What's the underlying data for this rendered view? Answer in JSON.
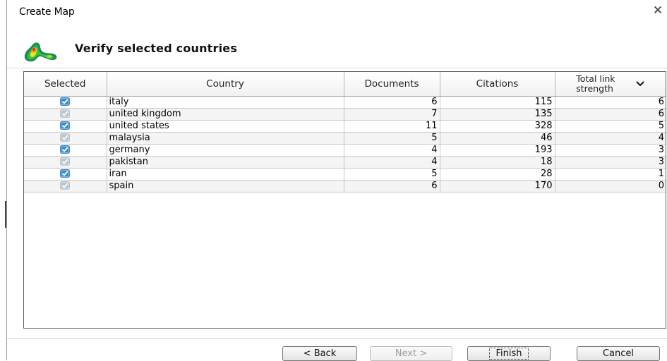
{
  "window": {
    "title": "Create Map",
    "close_icon": "close-icon"
  },
  "header": {
    "icon": "density-map-icon",
    "title": "Verify selected countries"
  },
  "table": {
    "columns": [
      "Selected",
      "Country",
      "Documents",
      "Citations",
      "Total link strength"
    ],
    "sorted_column": "Total link strength",
    "sort_direction": "descending",
    "rows": [
      {
        "selected": true,
        "country": "italy",
        "documents": "6",
        "citations": "115",
        "total_link_strength": "6"
      },
      {
        "selected": true,
        "country": "united kingdom",
        "documents": "7",
        "citations": "135",
        "total_link_strength": "6"
      },
      {
        "selected": true,
        "country": "united states",
        "documents": "11",
        "citations": "328",
        "total_link_strength": "5"
      },
      {
        "selected": true,
        "country": "malaysia",
        "documents": "5",
        "citations": "46",
        "total_link_strength": "4"
      },
      {
        "selected": true,
        "country": "germany",
        "documents": "4",
        "citations": "193",
        "total_link_strength": "3"
      },
      {
        "selected": true,
        "country": "pakistan",
        "documents": "4",
        "citations": "18",
        "total_link_strength": "3"
      },
      {
        "selected": true,
        "country": "iran",
        "documents": "5",
        "citations": "28",
        "total_link_strength": "1"
      },
      {
        "selected": true,
        "country": "spain",
        "documents": "6",
        "citations": "170",
        "total_link_strength": "0"
      }
    ]
  },
  "buttons": {
    "back": "< Back",
    "next": "Next >",
    "finish": "Finish",
    "cancel": "Cancel"
  },
  "colors": {
    "checkbox_blue": "#3d8bc9",
    "checkbox_gray": "#b7c3cc",
    "row_alt": "#f4f4f4"
  }
}
